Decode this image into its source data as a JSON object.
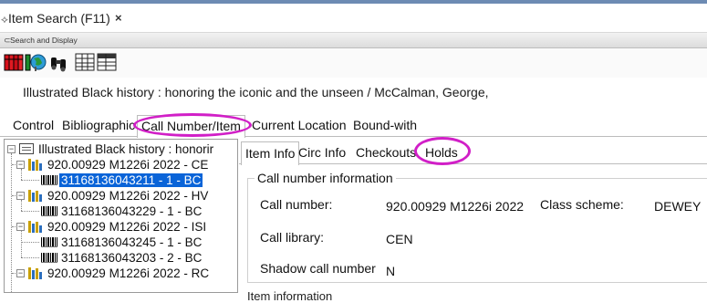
{
  "window": {
    "title": "Item Search (F11)",
    "close_glyph": "×",
    "section_label": "Search and Display"
  },
  "toolbar": {
    "buttons": [
      "books-icon",
      "globe-icon",
      "binoculars-icon",
      "list-grid-icon",
      "list-grid-alt-icon"
    ]
  },
  "record": {
    "title": "Illustrated Black history : honoring the iconic and the unseen / McCalman, George,"
  },
  "main_tabs": [
    "Control",
    "Bibliographic",
    "Call Number/Item",
    "Current Location",
    "Bound-with"
  ],
  "main_tabs_active": "Call Number/Item",
  "tree": {
    "root": "Illustrated Black history : honorir",
    "nodes": [
      {
        "type": "call",
        "label": "920.00929 M1226i 2022 - CE"
      },
      {
        "type": "item",
        "label": "31168136043211 - 1 - BC",
        "selected": true
      },
      {
        "type": "call",
        "label": "920.00929 M1226i 2022 - HV"
      },
      {
        "type": "item",
        "label": "31168136043229 - 1 - BC"
      },
      {
        "type": "call",
        "label": "920.00929 M1226i 2022 - ISI"
      },
      {
        "type": "item",
        "label": "31168136043245 - 1 - BC"
      },
      {
        "type": "item",
        "label": "31168136043203 - 2 - BC"
      },
      {
        "type": "call",
        "label": "920.00929 M1226i 2022 - RC"
      }
    ]
  },
  "sub_tabs": [
    "Item Info",
    "Circ Info",
    "Checkouts",
    "Holds"
  ],
  "sub_tabs_active": "Item Info",
  "call_number_group": {
    "legend": "Call number information",
    "call_number_label": "Call number:",
    "call_number_value": "920.00929 M1226i 2022",
    "class_scheme_label": "Class scheme:",
    "class_scheme_value": "DEWEY",
    "call_library_label": "Call library:",
    "call_library_value": "CEN",
    "shadow_label": "Shadow call number",
    "shadow_value": "N"
  },
  "item_info_section_label": "Item information",
  "highlight_color": "#d11fc7",
  "selection_color": "#0a64d8"
}
